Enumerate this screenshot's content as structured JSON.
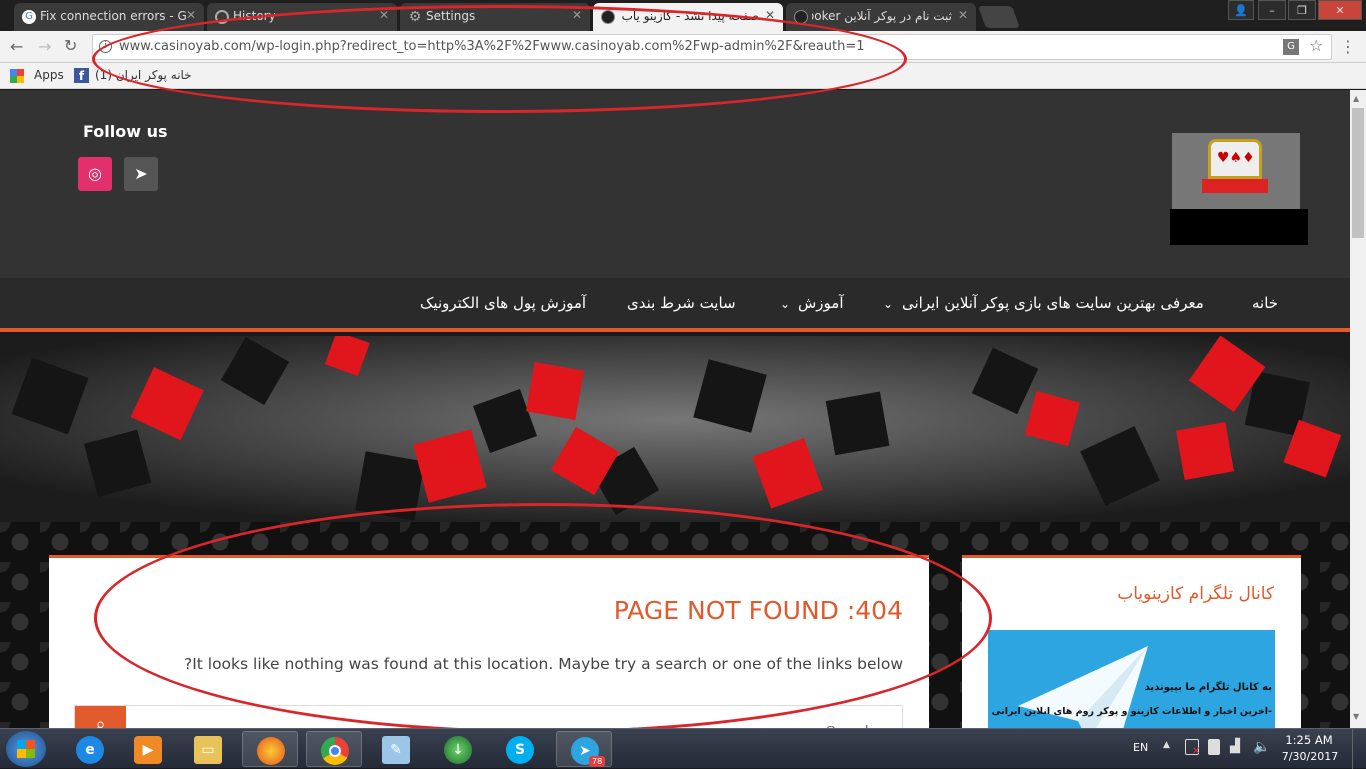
{
  "browser": {
    "tabs": [
      {
        "title": "Fix connection errors - G",
        "active": false,
        "icon": "google-icon"
      },
      {
        "title": "History",
        "active": false,
        "icon": "history-icon"
      },
      {
        "title": "Settings",
        "active": false,
        "icon": "settings-gear-icon"
      },
      {
        "title": "صفحه پیدا نشد - کازینو یاب - ...",
        "active": true,
        "icon": "site-icon"
      },
      {
        "title": "ثبت نام در پوکر آنلاین poker",
        "active": false,
        "icon": "site-icon"
      }
    ],
    "url": "www.casinoyab.com/wp-login.php?redirect_to=http%3A%2F%2Fwww.casinoyab.com%2Fwp-admin%2F&reauth=1",
    "bookmarks": {
      "apps_label": "Apps",
      "fb_label": "(1) خانه پوکر ایران"
    }
  },
  "site": {
    "follow_label": "Follow us",
    "nav": [
      {
        "label": "خانه"
      },
      {
        "label": "معرفی بهترین سایت های بازی پوکر آنلاین ایرانی",
        "dropdown": true
      },
      {
        "label": "آموزش",
        "dropdown": true
      },
      {
        "label": "سایت شرط بندی"
      },
      {
        "label": "آموزش پول های الکترونیک"
      }
    ],
    "main": {
      "title": "404: PAGE NOT FOUND",
      "message": "It looks like nothing was found at this location. Maybe try a search or one of the links below?",
      "search_placeholder": "Search ..."
    },
    "sidebar": {
      "title": "کانال تلگرام کازینویاب",
      "promo_line1": "به کانال تلگرام ما بپیوندید",
      "promo_line2": "-آخرین اخبار و اطلاعات کازینو و پوکر روم های آنلاین ایرانی"
    }
  },
  "taskbar": {
    "lang": "EN",
    "time": "1:25 AM",
    "date": "7/30/2017",
    "telegram_badge": "78"
  },
  "colors": {
    "accent": "#e05a2b",
    "annotation": "#d8262a",
    "header_bg": "#333333"
  }
}
